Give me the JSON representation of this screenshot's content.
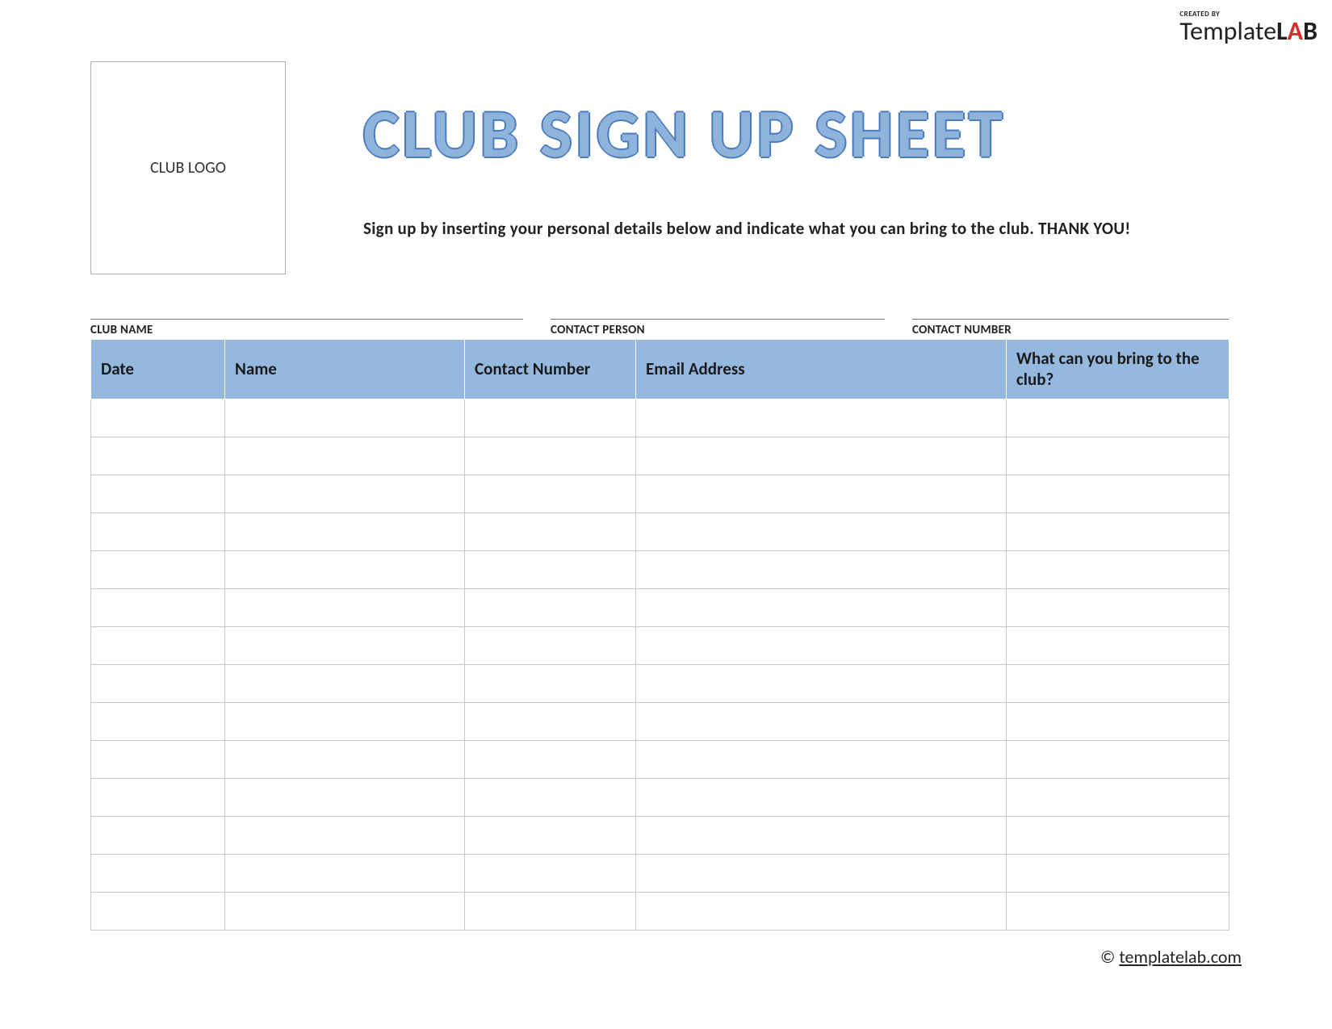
{
  "brand": {
    "created_by": "CREATED BY",
    "name_part1": "Template",
    "name_part2": "L",
    "name_part3": "A",
    "name_part4": "B"
  },
  "logo_box": {
    "label": "CLUB LOGO"
  },
  "title": "CLUB SIGN UP SHEET",
  "subtitle": "Sign up by inserting your personal details below and indicate what you can bring to the club. THANK YOU!",
  "meta": {
    "club_name": {
      "label": "CLUB NAME",
      "value": ""
    },
    "contact_person": {
      "label": "CONTACT PERSON",
      "value": ""
    },
    "contact_number": {
      "label": "CONTACT NUMBER",
      "value": ""
    }
  },
  "table": {
    "headers": {
      "date": "Date",
      "name": "Name",
      "contact": "Contact Number",
      "email": "Email Address",
      "bring": "What can you bring to the club?"
    },
    "rows": [
      {
        "date": "",
        "name": "",
        "contact": "",
        "email": "",
        "bring": ""
      },
      {
        "date": "",
        "name": "",
        "contact": "",
        "email": "",
        "bring": ""
      },
      {
        "date": "",
        "name": "",
        "contact": "",
        "email": "",
        "bring": ""
      },
      {
        "date": "",
        "name": "",
        "contact": "",
        "email": "",
        "bring": ""
      },
      {
        "date": "",
        "name": "",
        "contact": "",
        "email": "",
        "bring": ""
      },
      {
        "date": "",
        "name": "",
        "contact": "",
        "email": "",
        "bring": ""
      },
      {
        "date": "",
        "name": "",
        "contact": "",
        "email": "",
        "bring": ""
      },
      {
        "date": "",
        "name": "",
        "contact": "",
        "email": "",
        "bring": ""
      },
      {
        "date": "",
        "name": "",
        "contact": "",
        "email": "",
        "bring": ""
      },
      {
        "date": "",
        "name": "",
        "contact": "",
        "email": "",
        "bring": ""
      },
      {
        "date": "",
        "name": "",
        "contact": "",
        "email": "",
        "bring": ""
      },
      {
        "date": "",
        "name": "",
        "contact": "",
        "email": "",
        "bring": ""
      },
      {
        "date": "",
        "name": "",
        "contact": "",
        "email": "",
        "bring": ""
      },
      {
        "date": "",
        "name": "",
        "contact": "",
        "email": "",
        "bring": ""
      }
    ]
  },
  "footer": {
    "copyright": "©",
    "link_text": "templatelab.com"
  },
  "colors": {
    "header_bg": "#95b9de",
    "title_fill": "#8eb4dc",
    "title_stroke": "#4a7bbd",
    "border": "#c9c9c9",
    "accent_red": "#d92b2b"
  }
}
